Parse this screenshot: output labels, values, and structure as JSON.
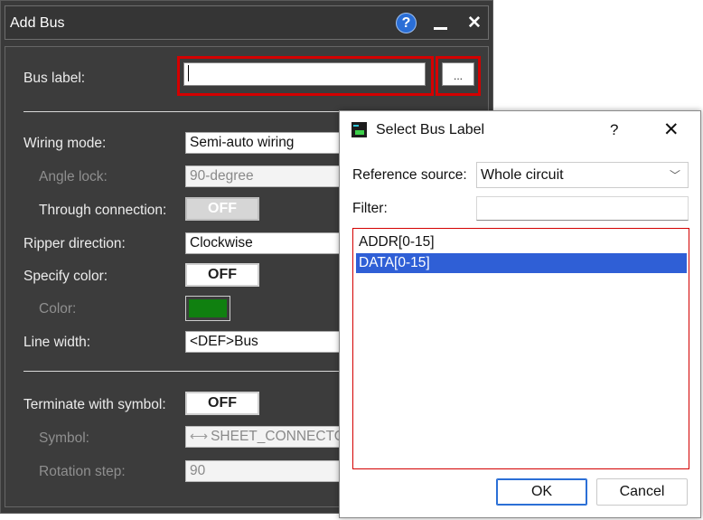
{
  "add_bus": {
    "title": "Add Bus",
    "bus_label": {
      "label": "Bus label:",
      "value": "",
      "browse_label": "..."
    },
    "wiring_mode": {
      "label": "Wiring mode:",
      "value": "Semi-auto wiring"
    },
    "angle_lock": {
      "label": "Angle lock:",
      "value": "90-degree"
    },
    "through_connection": {
      "label": "Through connection:",
      "state": "OFF"
    },
    "ripper_direction": {
      "label": "Ripper direction:",
      "value": "Clockwise"
    },
    "specify_color": {
      "label": "Specify color:",
      "state": "OFF"
    },
    "color": {
      "label": "Color:",
      "value_hex": "#108010"
    },
    "line_width": {
      "label": "Line width:",
      "value": "<DEF>Bus"
    },
    "terminate_with_symbol": {
      "label": "Terminate with symbol:",
      "state": "OFF"
    },
    "symbol": {
      "label": "Symbol:",
      "value": "SHEET_CONNECTO"
    },
    "rotation_step": {
      "label": "Rotation step:",
      "value": "90"
    }
  },
  "select_bus_label": {
    "title": "Select Bus Label",
    "help": "?",
    "close": "✕",
    "reference_source": {
      "label": "Reference source:",
      "value": "Whole circuit"
    },
    "filter": {
      "label": "Filter:",
      "value": ""
    },
    "items": [
      {
        "label": "ADDR[0-15]",
        "selected": false
      },
      {
        "label": "DATA[0-15]",
        "selected": true
      }
    ],
    "ok_label": "OK",
    "cancel_label": "Cancel"
  },
  "colors": {
    "highlight_red": "#d40000",
    "selection_blue": "#2f5fd6",
    "dark_bg": "#3c3c3c"
  }
}
